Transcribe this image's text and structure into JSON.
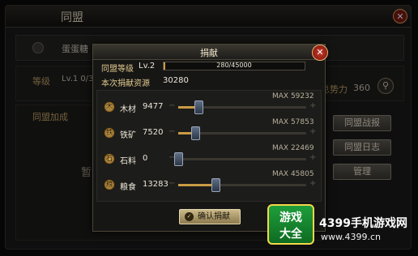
{
  "background": {
    "title": "同盟",
    "member_name": "蛋蛋糖",
    "level_label": "等级",
    "level_value": "Lv.1 0/300",
    "power_label": "总势力",
    "power_value": "360",
    "panel_title": "同盟加成",
    "panel_hint": "暂无",
    "side_buttons": [
      "同盟战报",
      "同盟日志",
      "管理"
    ]
  },
  "dialog": {
    "title": "捐献",
    "alliance_level_label": "同盟等级",
    "alliance_level_value": "Lv.2",
    "level_progress_text": "280/45000",
    "level_progress_fraction": 0.0062,
    "contribution_label": "本次捐献资源",
    "contribution_value": "30280",
    "resources": [
      {
        "name": "木材",
        "amount": "9477",
        "max_text": "MAX 59232",
        "fraction": 0.16,
        "icon": "wood-icon"
      },
      {
        "name": "铁矿",
        "amount": "7520",
        "max_text": "MAX 57853",
        "fraction": 0.13,
        "icon": "iron-icon"
      },
      {
        "name": "石料",
        "amount": "0",
        "max_text": "MAX 22469",
        "fraction": 0.0,
        "icon": "stone-icon"
      },
      {
        "name": "粮食",
        "amount": "13283",
        "max_text": "MAX 45805",
        "fraction": 0.29,
        "icon": "grain-icon"
      }
    ],
    "confirm_label": "确认捐献"
  },
  "watermark": {
    "logo_line1": "游戏",
    "logo_line2": "大全",
    "brand": "4399手机游戏网",
    "url": "www.4399.cn"
  },
  "colors": {
    "accent_gold": "#c99b43",
    "close_red": "#c4392a"
  }
}
